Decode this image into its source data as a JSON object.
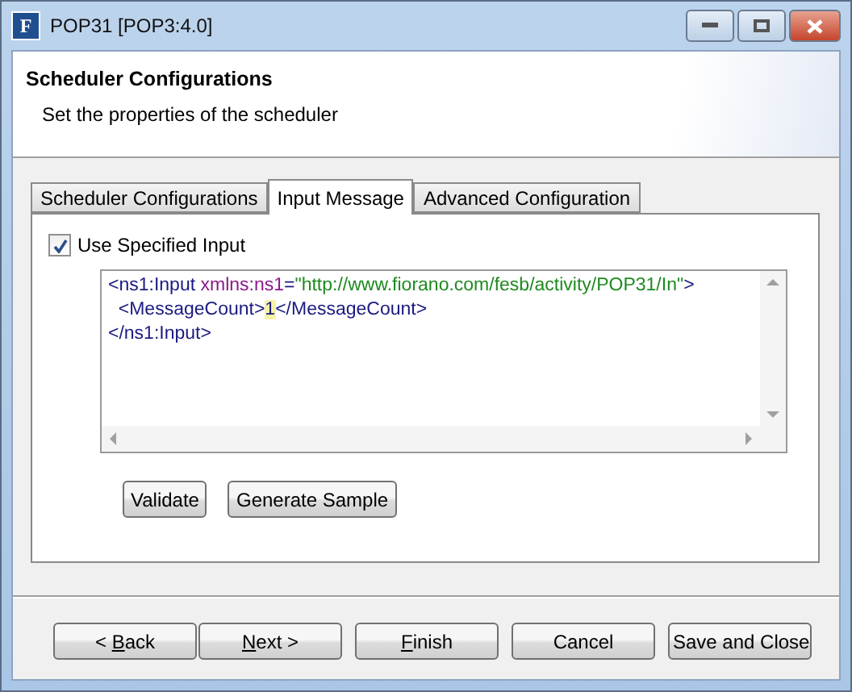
{
  "window": {
    "icon_letter": "F",
    "title": "POP31 [POP3:4.0]"
  },
  "header": {
    "title": "Scheduler Configurations",
    "subtitle": "Set the properties of the scheduler"
  },
  "tabs": [
    {
      "label": "Scheduler Configurations",
      "selected": false
    },
    {
      "label": "Input Message",
      "selected": true
    },
    {
      "label": "Advanced Configuration",
      "selected": false
    }
  ],
  "use_specified_input": {
    "label": "Use Specified Input",
    "checked": true
  },
  "editor": {
    "lines": [
      [
        {
          "kind": "tag",
          "text": "<ns1:Input "
        },
        {
          "kind": "attr",
          "text": "xmlns:ns1"
        },
        {
          "kind": "tag",
          "text": "="
        },
        {
          "kind": "string",
          "text": "\"http://www.fiorano.com/fesb/activity/POP31/In\""
        },
        {
          "kind": "tag",
          "text": ">"
        }
      ],
      [
        {
          "kind": "tag",
          "text": "  <MessageCount>"
        },
        {
          "kind": "highlight",
          "text": "1"
        },
        {
          "kind": "tag",
          "text": "</MessageCount>"
        }
      ],
      [
        {
          "kind": "tag",
          "text": "</ns1:Input>"
        }
      ]
    ]
  },
  "editor_buttons": [
    "Validate",
    "Generate Sample"
  ],
  "footer_buttons": [
    {
      "before": "< ",
      "accesskey": "B",
      "after": "ack"
    },
    {
      "accesskey": "N",
      "after": "ext >"
    },
    {
      "accesskey": "F",
      "after": "inish"
    },
    {
      "before": "Cancel"
    },
    {
      "before": "Save and Close"
    }
  ]
}
